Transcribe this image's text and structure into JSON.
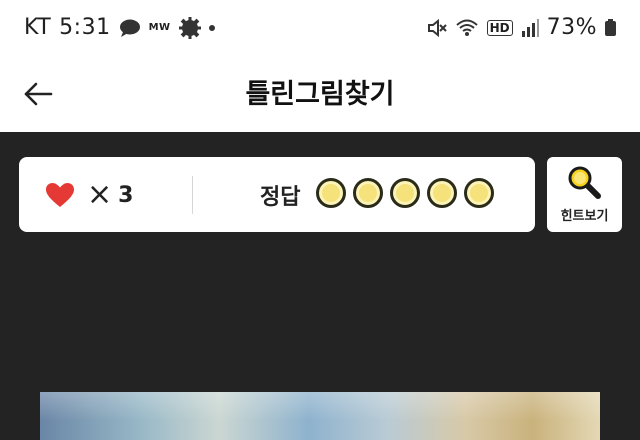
{
  "status_bar": {
    "carrier": "KT",
    "time": "5:31",
    "mw_label": "MW",
    "hd_label": "HD",
    "battery": "73%"
  },
  "app_bar": {
    "title": "틀린그림찾기",
    "back_icon": "arrow-left-icon"
  },
  "game": {
    "lives": {
      "icon": "heart-icon",
      "times": "×",
      "count": "3",
      "heart_color": "#e53935"
    },
    "answer_label": "정답",
    "answer_slots": 5,
    "slot_color": "#f6e27a",
    "hint": {
      "label": "힌트보기",
      "icon": "magnifier-icon"
    }
  },
  "colors": {
    "background": "#232323",
    "card": "#ffffff"
  }
}
